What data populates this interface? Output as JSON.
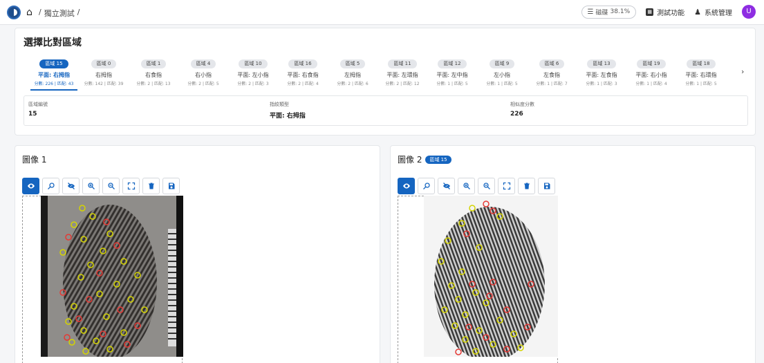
{
  "topbar": {
    "breadcrumbs": [
      "/",
      "獨立測試",
      "/"
    ],
    "memory_label": "磁碟",
    "memory_value": "38.1%",
    "menu_test": "測試功能",
    "menu_admin": "系統管理",
    "avatar_initial": "U"
  },
  "region_panel": {
    "title": "選擇比對區域",
    "tabs": [
      {
        "badge": "區域 15",
        "name": "平面: 右拇指",
        "score": "分數: 226 | 匹配: 43",
        "active": true
      },
      {
        "badge": "區域 0",
        "name": "右拇指",
        "score": "分數: 142 | 匹配: 39"
      },
      {
        "badge": "區域 1",
        "name": "右食指",
        "score": "分數: 2 | 匹配: 13"
      },
      {
        "badge": "區域 4",
        "name": "右小指",
        "score": "分數: 2 | 匹配: 5"
      },
      {
        "badge": "區域 10",
        "name": "平面: 左小指",
        "score": "分數: 2 | 匹配: 3"
      },
      {
        "badge": "區域 16",
        "name": "平面: 右食指",
        "score": "分數: 2 | 匹配: 4"
      },
      {
        "badge": "區域 5",
        "name": "左拇指",
        "score": "分數: 2 | 匹配: 6"
      },
      {
        "badge": "區域 11",
        "name": "平面: 左環指",
        "score": "分數: 2 | 匹配: 12"
      },
      {
        "badge": "區域 12",
        "name": "平面: 左中指",
        "score": "分數: 1 | 匹配: 5"
      },
      {
        "badge": "區域 9",
        "name": "左小指",
        "score": "分數: 1 | 匹配: 5"
      },
      {
        "badge": "區域 6",
        "name": "左食指",
        "score": "分數: 1 | 匹配: 7"
      },
      {
        "badge": "區域 13",
        "name": "平面: 左食指",
        "score": "分數: 1 | 匹配: 3"
      },
      {
        "badge": "區域 19",
        "name": "平面: 右小指",
        "score": "分數: 1 | 匹配: 4"
      },
      {
        "badge": "區域 18",
        "name": "平面: 右環指",
        "score": "分數: 1 | 匹配: 5"
      }
    ],
    "info": {
      "region_label": "區域編號",
      "region_value": "15",
      "type_label": "指紋類型",
      "type_value": "平面: 右拇指",
      "score_label": "相似度分數",
      "score_value": "226"
    }
  },
  "image1": {
    "title": "圖像 1"
  },
  "image2": {
    "title": "圖像 2",
    "badge": "區域 15"
  },
  "toolbar_icons": [
    "eye-icon",
    "search-minus-icon",
    "eye-off-icon",
    "zoom-in-icon",
    "zoom-out-icon",
    "fullscreen-icon",
    "trash-icon",
    "save-icon"
  ],
  "colors": {
    "accent": "#1565c0",
    "avatar": "#8e2de2",
    "match_marker": "#e53935",
    "minutia_marker": "#c9c900"
  }
}
